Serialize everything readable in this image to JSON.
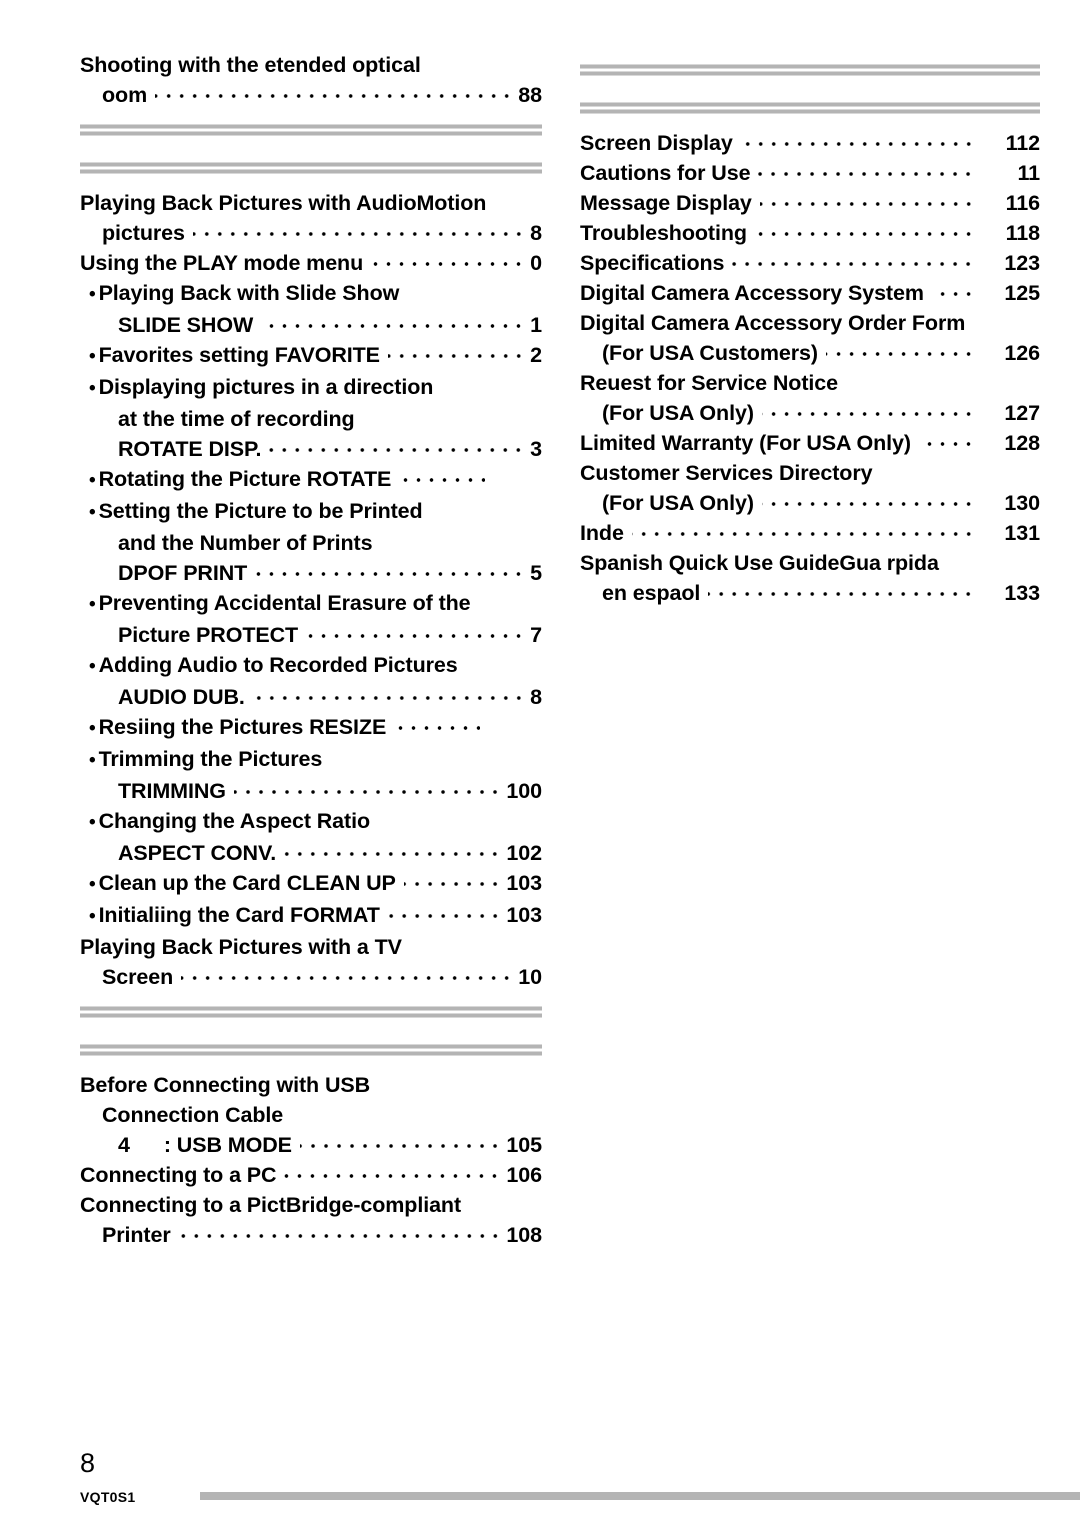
{
  "document": {
    "page_number": "8",
    "doc_code": "VQT0S1"
  },
  "left_column": {
    "entries": [
      {
        "id": "l0",
        "label": "Shooting with the etended optical",
        "kind": "heading",
        "indent": 0
      },
      {
        "id": "l1",
        "label": "oom",
        "page": "88",
        "kind": "leader",
        "indent": 1
      },
      {
        "id": "l2",
        "label": "Playing Back Pictures with AudioMotion",
        "kind": "heading",
        "indent": 0
      },
      {
        "id": "l3",
        "label": "pictures",
        "page": "8",
        "kind": "leader",
        "indent": 1
      },
      {
        "id": "l4",
        "label": "Using the PLAY mode menu",
        "page": "0",
        "kind": "leader",
        "indent": 0
      },
      {
        "id": "l5",
        "label": "Playing Back with Slide Show",
        "kind": "bullet",
        "indent": 1
      },
      {
        "id": "l6",
        "label": "SLIDE SHOW",
        "page": "1",
        "kind": "leader",
        "indent": 2
      },
      {
        "id": "l7",
        "label": "Favorites setting FAVORITE",
        "page": "2",
        "kind": "bullet-leader",
        "indent": 1
      },
      {
        "id": "l8",
        "label": "Displaying pictures in a direction",
        "kind": "bullet",
        "indent": 1
      },
      {
        "id": "l9",
        "label": "at the time of recording",
        "kind": "plain",
        "indent": 2
      },
      {
        "id": "l10",
        "label": "ROTATE DISP.",
        "page": "3",
        "kind": "leader",
        "indent": 2
      },
      {
        "id": "l11",
        "label": "Rotating the Picture ROTATE",
        "page": "",
        "kind": "bullet-leader",
        "indent": 1
      },
      {
        "id": "l12",
        "label": "Setting the Picture to be Printed",
        "kind": "bullet",
        "indent": 1
      },
      {
        "id": "l13",
        "label": "and the Number of Prints",
        "kind": "plain",
        "indent": 2
      },
      {
        "id": "l14",
        "label": "DPOF PRINT",
        "page": "5",
        "kind": "leader",
        "indent": 2
      },
      {
        "id": "l15",
        "label": "Preventing Accidental Erasure of the",
        "kind": "bullet",
        "indent": 1
      },
      {
        "id": "l16",
        "label": "Picture PROTECT",
        "page": "7",
        "kind": "leader",
        "indent": 2
      },
      {
        "id": "l17",
        "label": "Adding Audio to Recorded Pictures",
        "kind": "bullet",
        "indent": 1
      },
      {
        "id": "l18",
        "label": "AUDIO DUB.",
        "page": "8",
        "kind": "leader",
        "indent": 2
      },
      {
        "id": "l19",
        "label": "Resiing the Pictures RESIZE",
        "page": "",
        "kind": "bullet-leader",
        "indent": 1
      },
      {
        "id": "l20",
        "label": "Trimming the Pictures",
        "kind": "bullet",
        "indent": 1
      },
      {
        "id": "l21",
        "label": "TRIMMING",
        "page": "100",
        "kind": "leader",
        "indent": 2
      },
      {
        "id": "l22",
        "label": "Changing the Aspect Ratio",
        "kind": "bullet",
        "indent": 1
      },
      {
        "id": "l23",
        "label": "ASPECT CONV.",
        "page": "102",
        "kind": "leader",
        "indent": 2
      },
      {
        "id": "l24",
        "label": "Clean up the Card CLEAN UP",
        "page": "103",
        "kind": "bullet-leader",
        "indent": 1
      },
      {
        "id": "l25",
        "label": "Initialiing the Card FORMAT",
        "page": "103",
        "kind": "bullet-leader",
        "indent": 1
      },
      {
        "id": "l26",
        "label": "Playing Back Pictures with a TV",
        "kind": "heading",
        "indent": 0
      },
      {
        "id": "l27",
        "label": "Screen",
        "page": "10",
        "kind": "leader",
        "indent": 1
      },
      {
        "id": "l28",
        "label": "Before Connecting with USB",
        "kind": "heading",
        "indent": 0
      },
      {
        "id": "l29",
        "label": "Connection Cable",
        "kind": "plain",
        "indent": 1
      },
      {
        "id": "l30",
        "label": "4",
        "label2": ": USB MODE",
        "page": "105",
        "kind": "usbmode",
        "indent": 2
      },
      {
        "id": "l31",
        "label": "Connecting to a PC",
        "page": "106",
        "kind": "leader",
        "indent": 0
      },
      {
        "id": "l32",
        "label": "Connecting to a PictBridge-compliant",
        "kind": "heading",
        "indent": 0
      },
      {
        "id": "l33",
        "label": "Printer",
        "page": "108",
        "kind": "leader",
        "indent": 1
      }
    ]
  },
  "right_column": {
    "entries": [
      {
        "id": "r0",
        "label": "Screen Display",
        "page": "112",
        "kind": "leader",
        "indent": 0
      },
      {
        "id": "r1",
        "label": "Cautions for Use",
        "page": "11",
        "kind": "leader",
        "indent": 0
      },
      {
        "id": "r2",
        "label": "Message Display",
        "page": "116",
        "kind": "leader",
        "indent": 0
      },
      {
        "id": "r3",
        "label": "Troubleshooting",
        "page": "118",
        "kind": "leader",
        "indent": 0
      },
      {
        "id": "r4",
        "label": "Specifications",
        "page": "123",
        "kind": "leader",
        "indent": 0
      },
      {
        "id": "r5",
        "label": "Digital Camera Accessory System",
        "page": "125",
        "kind": "leader",
        "indent": 0
      },
      {
        "id": "r6",
        "label": "Digital Camera Accessory Order Form",
        "kind": "heading",
        "indent": 0
      },
      {
        "id": "r7",
        "label": "(For USA Customers)",
        "page": "126",
        "kind": "leader",
        "indent": 1
      },
      {
        "id": "r8",
        "label": "Reuest for Service Notice",
        "kind": "heading",
        "indent": 0
      },
      {
        "id": "r9",
        "label": "(For USA Only)",
        "page": "127",
        "kind": "leader",
        "indent": 1
      },
      {
        "id": "r10",
        "label": "Limited Warranty (For USA Only)",
        "page": "128",
        "kind": "leader",
        "indent": 0
      },
      {
        "id": "r11",
        "label": "Customer Services Directory",
        "kind": "heading",
        "indent": 0
      },
      {
        "id": "r12",
        "label": "(For USA Only)",
        "page": "130",
        "kind": "leader",
        "indent": 1
      },
      {
        "id": "r13",
        "label": "Inde",
        "page": "131",
        "kind": "leader",
        "indent": 0
      },
      {
        "id": "r14",
        "label": "Spanish Quick Use GuideGua rpida",
        "kind": "heading",
        "indent": 0
      },
      {
        "id": "r15",
        "label": "en espaol",
        "page": "133",
        "kind": "leader",
        "indent": 1
      }
    ]
  },
  "styles": {
    "rule_color": "#b4b4b4",
    "text_color": "#000000",
    "background": "#ffffff"
  }
}
